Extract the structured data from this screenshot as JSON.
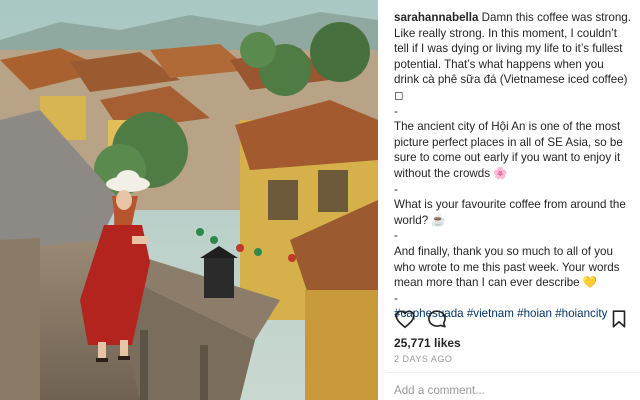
{
  "post": {
    "username": "sarahannabella",
    "caption_intro": "Damn this coffee was strong. Like really strong. In this moment, I couldn’t tell if I was dying or living my life to it’s fullest potential. That’s what happens when you drink cà phê sữa đá (Vietnamese iced coffee) ◻",
    "separator": "-",
    "caption_p2": "The ancient city of Hội An is one of the most picture perfect places in all of SE Asia, so be sure to come out early if you want to enjoy it without the crowds 🌸",
    "caption_p3": "What is your favourite coffee from around the world? ☕",
    "caption_p4": "And finally, thank you so much to all of you who wrote to me this past week. Your words mean more than I can ever describe 💛",
    "hashtags": [
      "#caphesuada",
      "#vietnam",
      "#hoian",
      "#hoiancity"
    ],
    "likes": "25,771 likes",
    "time_ago": "2 DAYS AGO",
    "comment_placeholder": "Add a comment..."
  },
  "icons": {
    "like": "heart-icon",
    "comment": "comment-bubble-icon",
    "save": "bookmark-icon"
  },
  "colors": {
    "text": "#262626",
    "hashtag": "#003569",
    "muted": "#999999",
    "divider": "#efefef"
  }
}
